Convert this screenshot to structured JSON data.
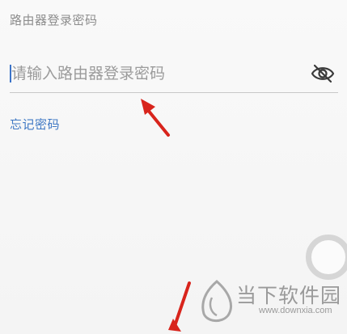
{
  "form": {
    "label": "路由器登录密码",
    "placeholder": "请输入路由器登录密码",
    "value": "",
    "forgot_link": "忘记密码"
  },
  "icons": {
    "visibility_toggle": "eye-off-icon",
    "annotation_arrow": "red-arrow-icon",
    "floating_button": "ring-icon"
  },
  "watermark": {
    "brand": "当下软件园",
    "url": "www.downxia.com"
  },
  "colors": {
    "accent": "#3f78c4",
    "label": "#8d8d8d",
    "arrow": "#d8241c",
    "watermark": "#9a9a9a"
  }
}
